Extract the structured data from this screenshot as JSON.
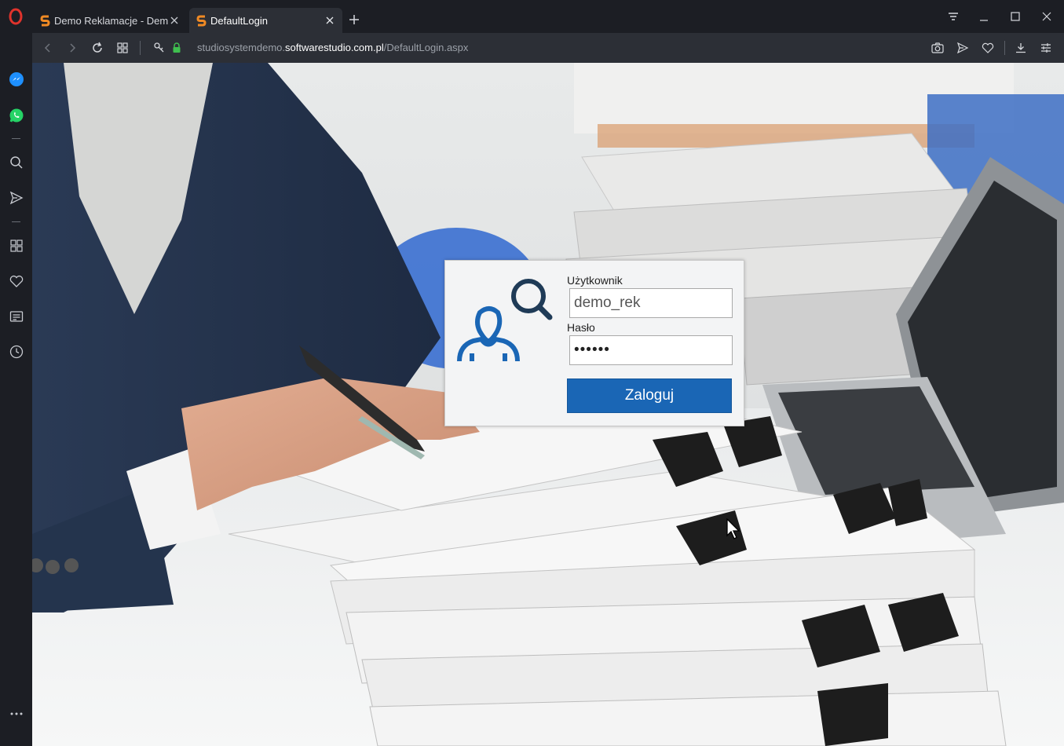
{
  "browser": {
    "tabs": [
      {
        "title": "Demo Reklamacje - Demo",
        "active": false
      },
      {
        "title": "DefaultLogin",
        "active": true
      }
    ],
    "url": {
      "prefix": "studiosystemdemo.",
      "domain": "softwarestudio.com.pl",
      "path": "/DefaultLogin.aspx"
    },
    "icons": {
      "back": "back-arrow-icon",
      "forward": "forward-arrow-icon",
      "reload": "reload-icon",
      "tabs": "speed-dial-grid-icon",
      "security": "lock-icon",
      "snapshot": "camera-icon",
      "send": "send-icon",
      "bookmark": "heart-icon",
      "downloads": "download-icon",
      "easy_setup": "settings-sliders-icon"
    },
    "accent_color": "#e0332c"
  },
  "sidebar": {
    "items": [
      {
        "name": "messenger",
        "color": "#1e90ff"
      },
      {
        "name": "whatsapp",
        "color": "#25d366"
      },
      {
        "name": "search"
      },
      {
        "name": "send"
      },
      {
        "name": "speed-dial"
      },
      {
        "name": "bookmarks"
      },
      {
        "name": "news"
      },
      {
        "name": "history"
      }
    ]
  },
  "login": {
    "username_label": "Użytkownik",
    "username_value": "demo_rek",
    "password_label": "Hasło",
    "password_value": "••••••",
    "submit_label": "Zaloguj",
    "button_color": "#1a66b5"
  }
}
